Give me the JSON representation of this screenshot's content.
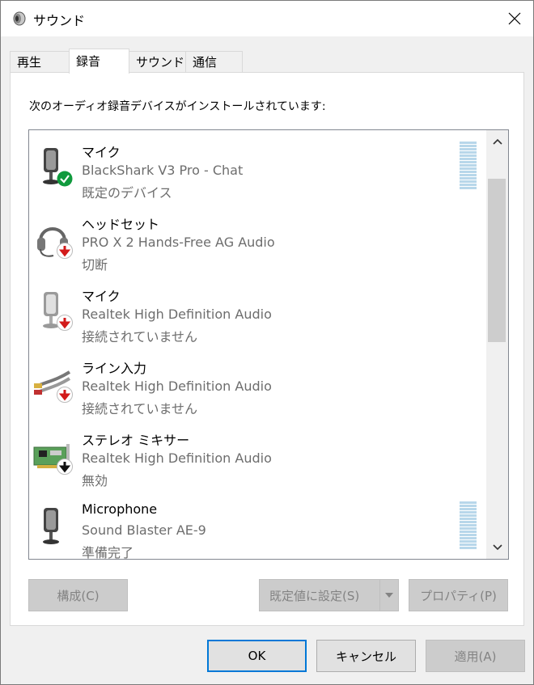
{
  "window": {
    "title": "サウンド"
  },
  "tabs": [
    {
      "label": "再生"
    },
    {
      "label": "録音"
    },
    {
      "label": "サウンド"
    },
    {
      "label": "通信"
    }
  ],
  "instruction": "次のオーディオ録音デバイスがインストールされています:",
  "devices": [
    {
      "name": "マイク",
      "description": "BlackShark V3 Pro - Chat",
      "status": "既定のデバイス",
      "badge": "check"
    },
    {
      "name": "ヘッドセット",
      "description": "PRO X 2 Hands-Free AG Audio",
      "status": "切断",
      "badge": "red-down-arrow"
    },
    {
      "name": "マイク",
      "description": "Realtek High Definition Audio",
      "status": "接続されていません",
      "badge": "red-down-arrow"
    },
    {
      "name": "ライン入力",
      "description": "Realtek High Definition Audio",
      "status": "接続されていません",
      "badge": "red-down-arrow"
    },
    {
      "name": "ステレオ ミキサー",
      "description": "Realtek High Definition Audio",
      "status": "無効",
      "badge": "black-down-arrow"
    },
    {
      "name": "Microphone",
      "description": "Sound Blaster AE-9",
      "status": "準備完了",
      "badge": "none"
    }
  ],
  "buttons": {
    "configure": "構成(C)",
    "set_default": "既定値に設定(S)",
    "properties": "プロパティ(P)",
    "ok": "OK",
    "cancel": "キャンセル",
    "apply": "適用(A)"
  },
  "colors": {
    "accent": "#0078d7",
    "check_badge": "#109a3d",
    "red_badge": "#d21a1a",
    "level_meter": "#b8d7ea"
  }
}
